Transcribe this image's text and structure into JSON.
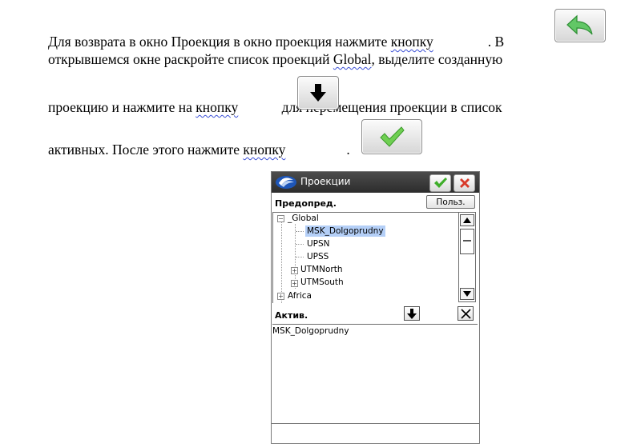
{
  "instructions": {
    "line1_before": "Для возврата в окно Проекция в окно проекция нажмите ",
    "line1_spell": "кнопку",
    "line1_after": ". В",
    "line2_before": "открывшемся окне раскройте список проекций ",
    "line2_spell": "Global",
    "line2_after": ", выделите созданную",
    "line3_before": "проекцию и нажмите на ",
    "line3_spell": "кнопку",
    "line3_after": " для перемещения проекции в список",
    "line4_before": "активных. После этого нажмите ",
    "line4_spell": "кнопку",
    "line4_after": "."
  },
  "icons": {
    "back": "back-arrow-icon",
    "move_down": "arrow-down-icon",
    "ok": "checkmark-icon",
    "cancel": "close-x-icon",
    "clear": "clear-x-icon",
    "logo": "app-logo-icon"
  },
  "colors": {
    "check_green": "#3fae2a",
    "back_arrow_green": "#5bbf5e",
    "close_red": "#d83a2a",
    "selection": "#b4cff7",
    "title_bar": "#3a3a3a"
  },
  "window": {
    "title": "Проекции",
    "predef_label": "Предопред.",
    "user_button": "Польз.",
    "tree": {
      "root": "_Global",
      "children": [
        "MSK_Dolgoprudny",
        "UPSN",
        "UPSS",
        "UTMNorth",
        "UTMSouth"
      ],
      "selected": "MSK_Dolgoprudny",
      "next_root": "Africa"
    },
    "active_label": "Актив.",
    "active_items": [
      "MSK_Dolgoprudny"
    ]
  }
}
